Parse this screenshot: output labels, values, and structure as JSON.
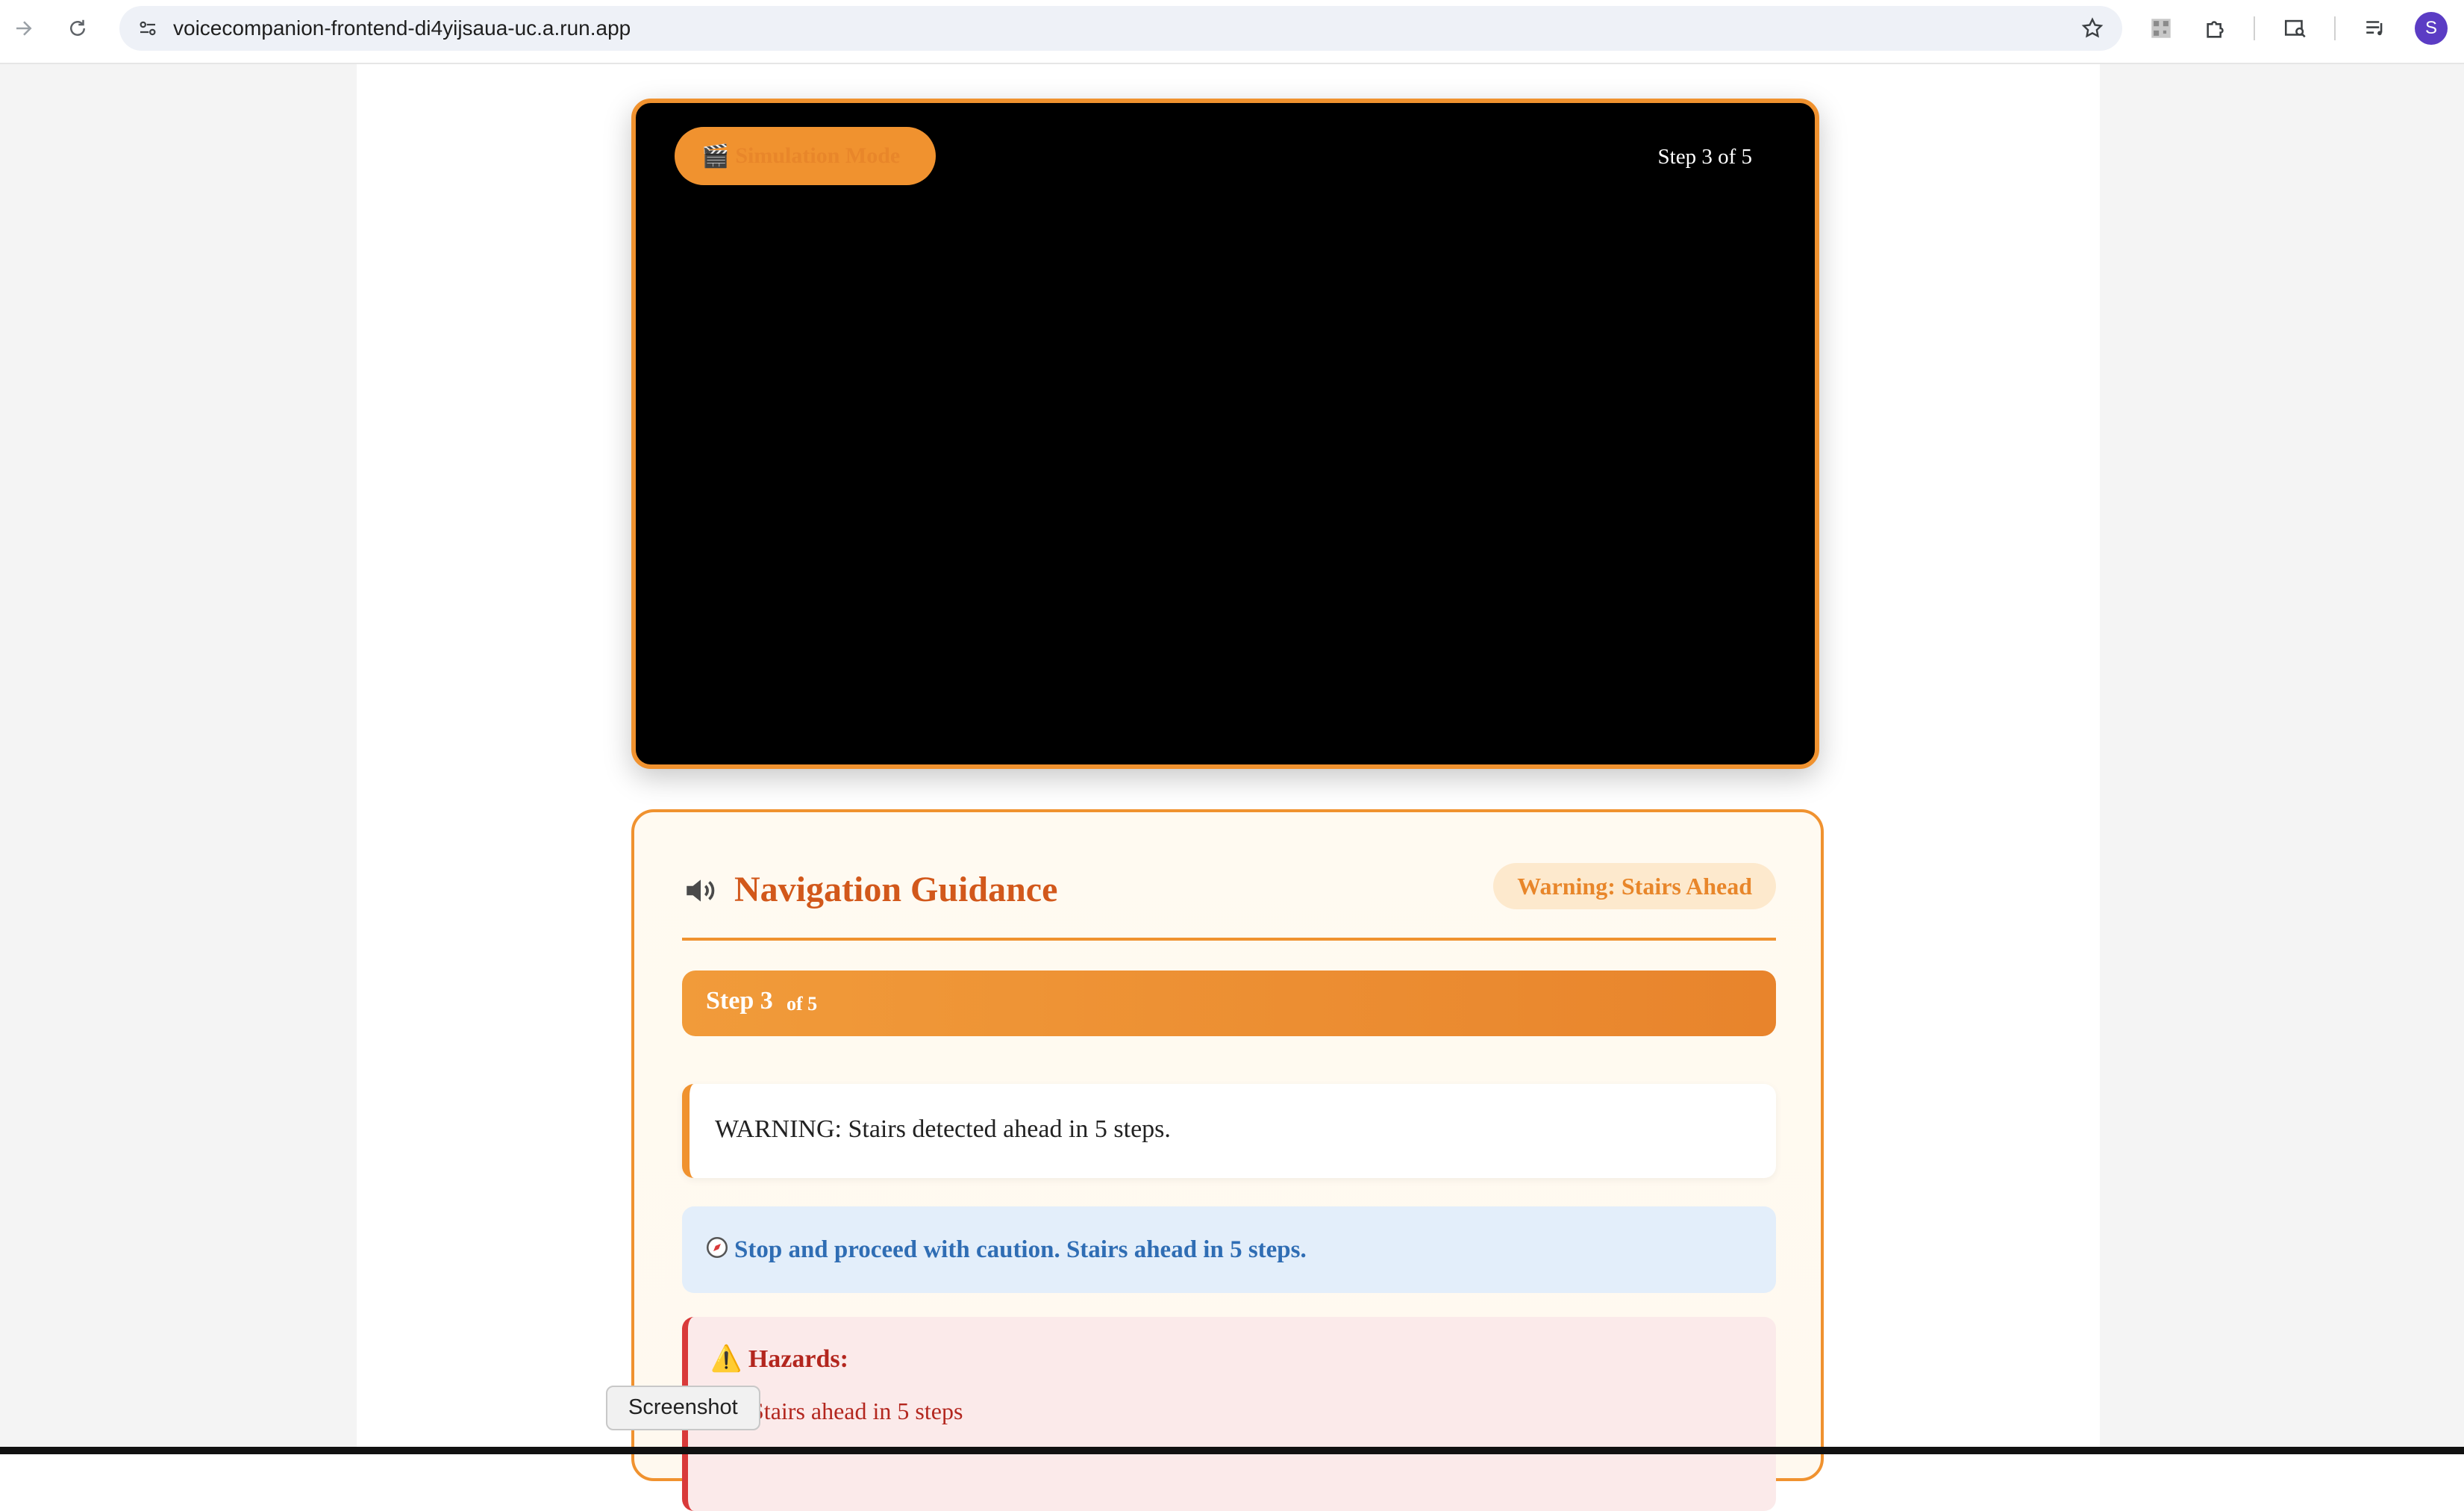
{
  "browser": {
    "url": "voicecompanion-frontend-di4yijsaua-uc.a.run.app",
    "profile_initial": "S",
    "icons": [
      "forward-icon",
      "reload-icon",
      "site-info-icon",
      "bookmark-star-icon",
      "extension-qr-icon",
      "extensions-puzzle-icon",
      "tab-search-icon",
      "media-control-icon"
    ]
  },
  "video": {
    "mode_label": "Simulation Mode",
    "mode_icon": "clapper-board-icon",
    "step_label": "Step 3 of 5"
  },
  "guidance": {
    "title": "Navigation Guidance",
    "badge": "Warning: Stairs Ahead",
    "step_main": "Step 3",
    "step_of": "of 5",
    "message": "WARNING: Stairs detected ahead in 5 steps.",
    "instruction": "Stop and proceed with caution. Stairs ahead in 5 steps.",
    "hazards_title": "Hazards:",
    "hazards": [
      "Stairs ahead in 5 steps"
    ]
  },
  "tooltip": "Screenshot",
  "colors": {
    "accent": "#f0922f",
    "title": "#d2581b",
    "instruction": "#2f6db4",
    "hazard": "#b3261e"
  }
}
